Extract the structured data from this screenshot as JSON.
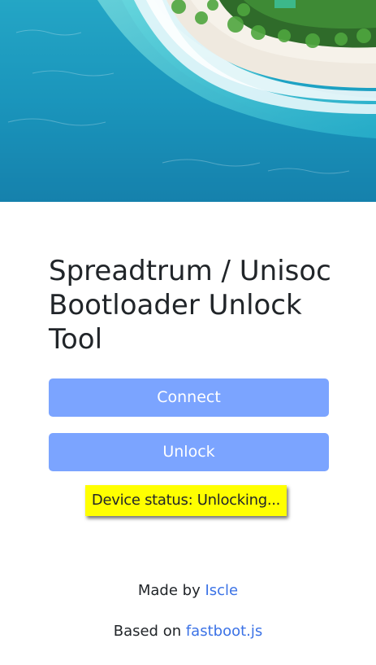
{
  "hero": {
    "image": "aerial beach photo - turquoise sea, white sand, palm trees"
  },
  "main": {
    "title": "Spreadtrum / Unisoc Bootloader Unlock Tool",
    "connect_label": "Connect",
    "unlock_label": "Unlock",
    "status_text": "Device status: Unlocking..."
  },
  "footer": {
    "made_by_prefix": "Made by ",
    "author_link": "Iscle",
    "based_on_prefix": "Based on ",
    "library_link": "fastboot.js"
  },
  "colors": {
    "button_bg": "#7ba4ff",
    "status_bg": "#ffff00",
    "link": "#3b72e6"
  }
}
